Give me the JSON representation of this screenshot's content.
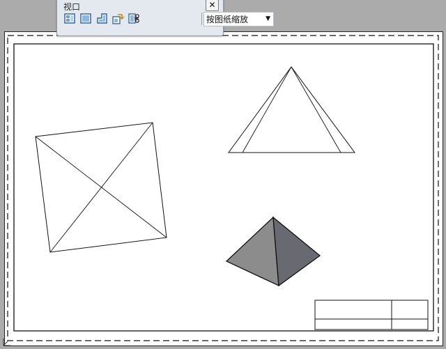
{
  "toolbar": {
    "title": "视口",
    "close_label": "✕",
    "scale_dropdown": {
      "value": "按图纸缩放"
    },
    "buttons": [
      {
        "icon": "viewport-dialog-icon"
      },
      {
        "icon": "single-viewport-icon"
      },
      {
        "icon": "polygonal-viewport-icon"
      },
      {
        "icon": "convert-object-viewport-icon"
      },
      {
        "icon": "clip-viewport-icon"
      }
    ]
  },
  "colors": {
    "background": "#ababab",
    "paper": "#ffffff",
    "pyramid_light": "#8a8a8a",
    "pyramid_dark": "#6b6b72"
  }
}
